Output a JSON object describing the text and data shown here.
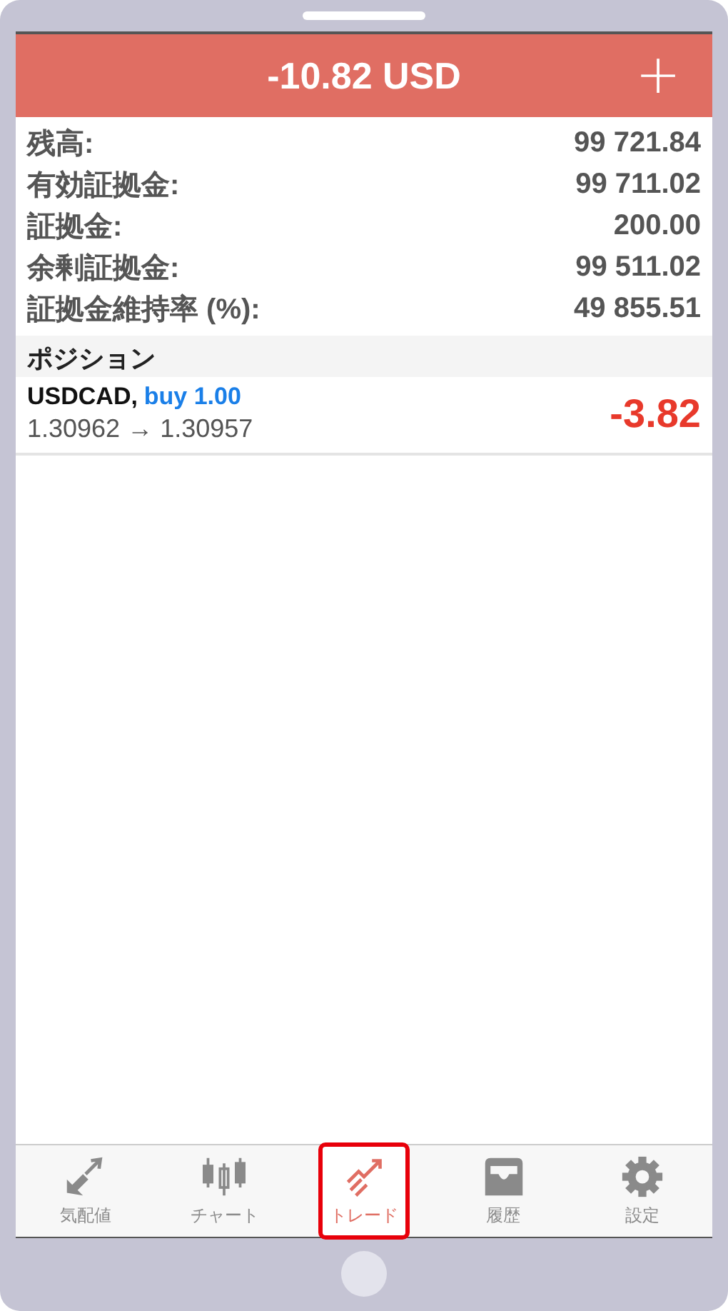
{
  "header": {
    "title": "-10.82 USD",
    "add_button": "+"
  },
  "account": [
    {
      "label": "残高:",
      "value": "99 721.84"
    },
    {
      "label": "有効証拠金:",
      "value": "99 711.02"
    },
    {
      "label": "証拠金:",
      "value": "200.00"
    },
    {
      "label": "余剰証拠金:",
      "value": "99 511.02"
    },
    {
      "label": "証拠金維持率 (%):",
      "value": "49 855.51"
    }
  ],
  "positions": {
    "heading": "ポジション",
    "rows": [
      {
        "symbol": "USDCAD,",
        "order": "buy 1.00",
        "prices": "1.30962 → 1.30957",
        "profit": "-3.82"
      }
    ]
  },
  "tabs": [
    {
      "label": "気配値",
      "selected": false
    },
    {
      "label": "チャート",
      "selected": false
    },
    {
      "label": "トレード",
      "selected": true
    },
    {
      "label": "履歴",
      "selected": false
    },
    {
      "label": "設定",
      "selected": false
    }
  ]
}
